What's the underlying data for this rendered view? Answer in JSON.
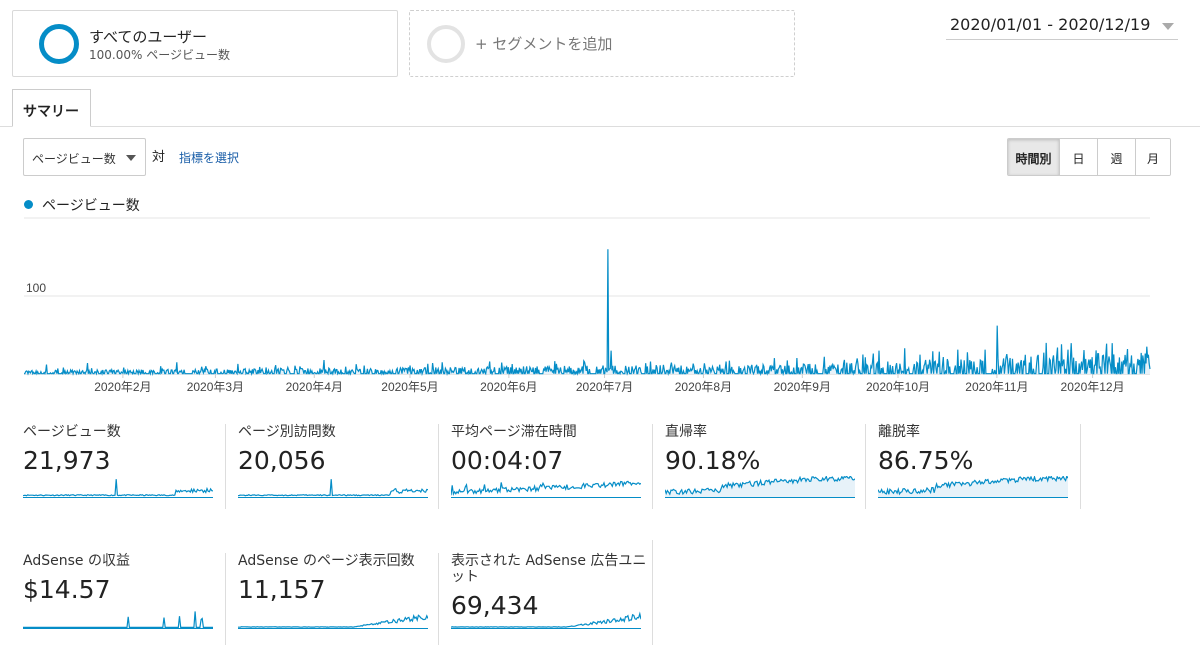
{
  "segments": {
    "all_users": {
      "title": "すべてのユーザー",
      "subtitle": "100.00% ページビュー数"
    },
    "add_segment_label": "+ セグメントを追加"
  },
  "date_range": "2020/01/01 - 2020/12/19",
  "tabs": {
    "summary": "サマリー"
  },
  "controls": {
    "metric_selected": "ページビュー数",
    "vs_label": "対",
    "choose_metric": "指標を選択",
    "periods": [
      "時間別",
      "日",
      "週",
      "月"
    ],
    "active_period": "時間別"
  },
  "colors": {
    "accent": "#058dc7",
    "fill": "#e7f2f9"
  },
  "chart_data": {
    "type": "line",
    "series": [
      {
        "name": "ページビュー数",
        "peaks": [
          {
            "date": "2020-01-08",
            "value": 12
          },
          {
            "date": "2020-01-21",
            "value": 14
          },
          {
            "date": "2020-02-18",
            "value": 15
          },
          {
            "date": "2020-03-08",
            "value": 13
          },
          {
            "date": "2020-04-04",
            "value": 18
          },
          {
            "date": "2020-05-11",
            "value": 15
          },
          {
            "date": "2020-05-26",
            "value": 16
          },
          {
            "date": "2020-06-16",
            "value": 13
          },
          {
            "date": "2020-07-02",
            "value": 160
          },
          {
            "date": "2020-07-03",
            "value": 30
          },
          {
            "date": "2020-08-08",
            "value": 16
          },
          {
            "date": "2020-09-08",
            "value": 22
          },
          {
            "date": "2020-09-25",
            "value": 30
          },
          {
            "date": "2020-10-03",
            "value": 33
          },
          {
            "date": "2020-11-01",
            "value": 62
          },
          {
            "date": "2020-11-20",
            "value": 34
          },
          {
            "date": "2020-12-12",
            "value": 32
          },
          {
            "date": "2020-12-18",
            "value": 35
          }
        ],
        "baseline": [
          {
            "date": "2020-01-01",
            "value": 3
          },
          {
            "date": "2020-05-01",
            "value": 5
          },
          {
            "date": "2020-07-01",
            "value": 7
          },
          {
            "date": "2020-09-01",
            "value": 8
          },
          {
            "date": "2020-10-15",
            "value": 12
          },
          {
            "date": "2020-12-19",
            "value": 18
          }
        ]
      }
    ],
    "y_ticks": [
      100,
      200
    ],
    "ylim": [
      0,
      200
    ],
    "xlim": [
      "2020-01-01",
      "2020-12-19"
    ],
    "x_ticks": [
      {
        "date": "2020-02-01",
        "label": "2020年2月"
      },
      {
        "date": "2020-03-01",
        "label": "2020年3月"
      },
      {
        "date": "2020-04-01",
        "label": "2020年4月"
      },
      {
        "date": "2020-05-01",
        "label": "2020年5月"
      },
      {
        "date": "2020-06-01",
        "label": "2020年6月"
      },
      {
        "date": "2020-07-01",
        "label": "2020年7月"
      },
      {
        "date": "2020-08-01",
        "label": "2020年8月"
      },
      {
        "date": "2020-09-01",
        "label": "2020年9月"
      },
      {
        "date": "2020-10-01",
        "label": "2020年10月"
      },
      {
        "date": "2020-11-01",
        "label": "2020年11月"
      },
      {
        "date": "2020-12-01",
        "label": "2020年12月"
      }
    ],
    "grid": true
  },
  "metrics": [
    {
      "label": "ページビュー数",
      "value": "21,973",
      "trend": "spike-mid"
    },
    {
      "label": "ページ別訪問数",
      "value": "20,056",
      "trend": "spike-mid"
    },
    {
      "label": "平均ページ滞在時間",
      "value": "00:04:07",
      "trend": "rising-noisy"
    },
    {
      "label": "直帰率",
      "value": "90.18%",
      "trend": "high-plateau"
    },
    {
      "label": "離脱率",
      "value": "86.75%",
      "trend": "high-plateau"
    },
    {
      "label": "AdSense の収益",
      "value": "$14.57",
      "trend": "sparse-spikes"
    },
    {
      "label": "AdSense のページ表示回数",
      "value": "11,157",
      "trend": "rising-late"
    },
    {
      "label": "表示された AdSense 広告ユニット",
      "value": "69,434",
      "trend": "rising-late"
    }
  ]
}
